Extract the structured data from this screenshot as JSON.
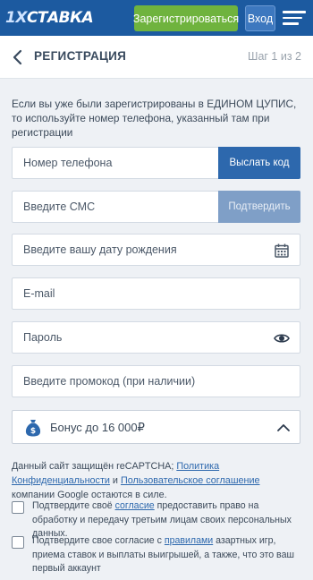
{
  "topbar": {
    "logo_prefix": "1X",
    "logo_main": "СТАВКА",
    "register_label": "Зарегистрироваться",
    "login_label": "Вход"
  },
  "header": {
    "title": "РЕГИСТРАЦИЯ",
    "step": "Шаг 1 из 2"
  },
  "info_text": "Если вы уже были зарегистрированы в ЕДИНОМ ЦУПИС, то используйте номер телефона, указанный там при регистрации",
  "form": {
    "phone_placeholder": "Номер телефона",
    "send_code_label": "Выслать код",
    "sms_placeholder": "Введите СМС",
    "confirm_label": "Подтвердить",
    "birthdate_placeholder": "Введите вашу дату рождения",
    "email_placeholder": "E-mail",
    "password_placeholder": "Пароль",
    "promo_placeholder": "Введите промокод (при наличии)"
  },
  "bonus": {
    "label": "Бонус до 16 000₽"
  },
  "captcha": {
    "text_before": "Данный сайт защищён reCAPTCHA; ",
    "privacy_link": "Политика Конфиденциальности",
    "text_and": " и ",
    "terms_link": "Пользовательское соглашение",
    "text_after": " компании Google остаются в силе."
  },
  "consent1": {
    "text_before": "Подтвердите своё ",
    "link": "согласие",
    "text_after": " предоставить право на обработку и передачу третьим лицам своих персональных данных.",
    "checked": false
  },
  "consent2": {
    "text_before": "Подтвердите свое согласие с ",
    "link": "правилами",
    "text_after": " азартных игр, приема ставок и выплаты выигрышей, а также, что это ваш первый аккаунт",
    "checked": false
  },
  "colors": {
    "brand": "#1c5aa0",
    "register_green": "#6fb33e",
    "action_blue": "#2d68ad",
    "action_disabled": "#7f9fc7",
    "link": "#2d68ad"
  }
}
